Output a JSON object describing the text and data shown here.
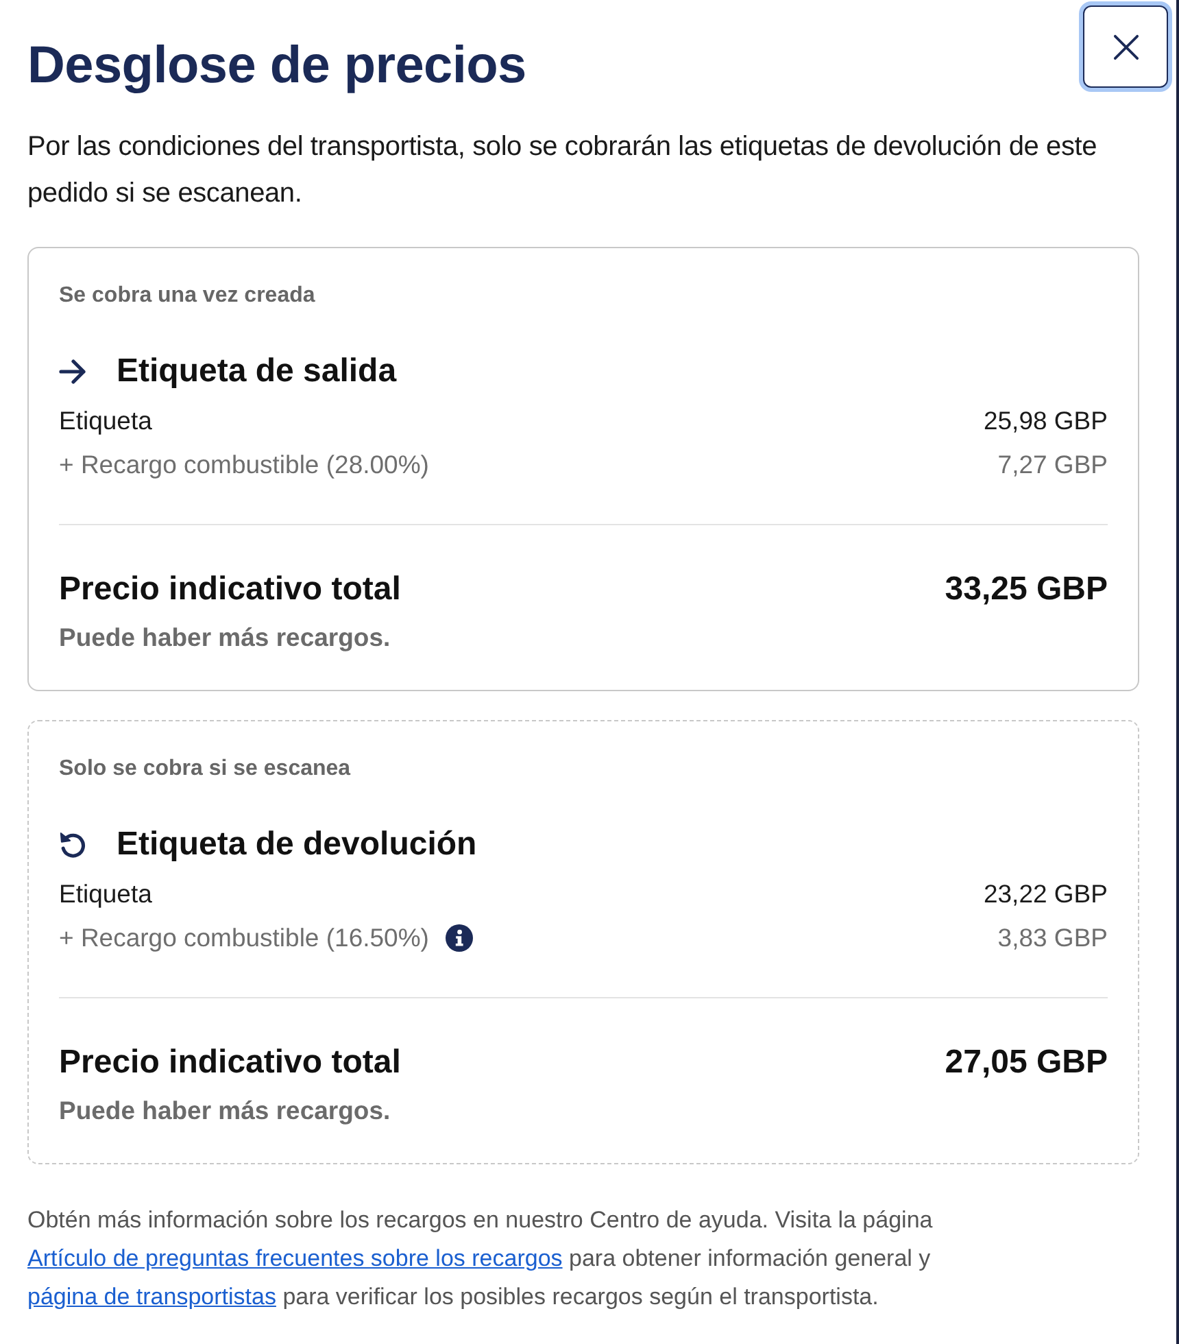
{
  "title": "Desglose de precios",
  "intro": "Por las condiciones del transportista, solo se cobrarán las etiquetas de devolución de este pedido si se escanean.",
  "sections": [
    {
      "kind": "outbound",
      "caption": "Se cobra una vez creada",
      "heading": "Etiqueta de salida",
      "lines": [
        {
          "kind": "base",
          "label": "Etiqueta",
          "amount": "25,98 GBP",
          "info": false
        },
        {
          "kind": "surcharge",
          "label": "+ Recargo combustible (28.00%)",
          "amount": "7,27 GBP",
          "info": false
        }
      ],
      "total_label": "Precio indicativo total",
      "total": "33,25 GBP",
      "note": "Puede haber más recargos."
    },
    {
      "kind": "return",
      "caption": "Solo se cobra si se escanea",
      "heading": "Etiqueta de devolución",
      "lines": [
        {
          "kind": "base",
          "label": "Etiqueta",
          "amount": "23,22 GBP",
          "info": false
        },
        {
          "kind": "surcharge",
          "label": "+ Recargo combustible (16.50%)",
          "amount": "3,83 GBP",
          "info": true
        }
      ],
      "total_label": "Precio indicativo total",
      "total": "27,05 GBP",
      "note": "Puede haber más recargos."
    }
  ],
  "footer": [
    {
      "kind": "text",
      "text": "Obtén más información sobre los recargos en nuestro Centro de ayuda. Visita la página"
    },
    {
      "kind": "link",
      "text": "Artículo de preguntas frecuentes sobre los recargos"
    },
    {
      "kind": "text",
      "text": "para obtener información general y"
    },
    {
      "kind": "link",
      "text": "página de transportistas"
    },
    {
      "kind": "text",
      "text": "para verificar los posibles recargos según el transportista."
    }
  ]
}
